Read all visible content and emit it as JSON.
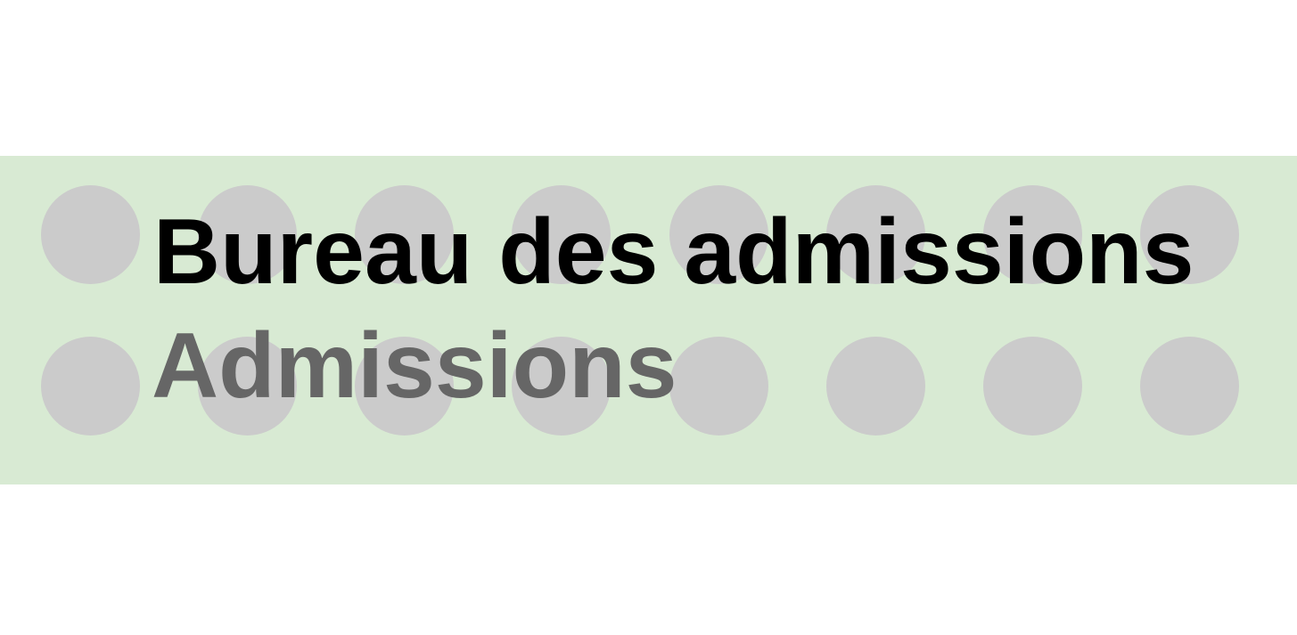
{
  "sign": {
    "primary_text": "Bureau des admissions",
    "secondary_text": "Admissions"
  },
  "colors": {
    "background": "#ffffff",
    "band": "#d8ead3",
    "dot": "#cbcbcb",
    "primary_text": "#000000",
    "secondary_text": "#666666"
  }
}
